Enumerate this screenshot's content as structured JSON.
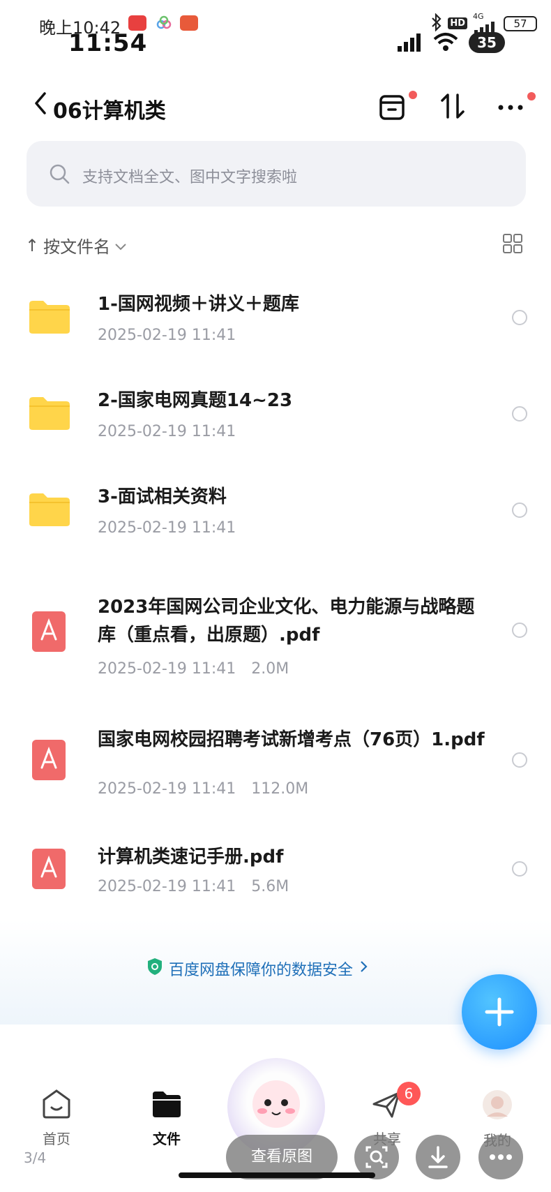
{
  "status_bar": {
    "time_small": "晚上10:42",
    "time_big": "11:54",
    "network": "4G",
    "battery": "57",
    "pill": "35"
  },
  "header": {
    "title": "06计算机类"
  },
  "search": {
    "placeholder": "支持文档全文、图中文字搜索啦"
  },
  "sort": {
    "label": "按文件名"
  },
  "files": [
    {
      "type": "folder",
      "name": "1-国网视频＋讲义＋题库",
      "date": "2025-02-19 11:41",
      "size": ""
    },
    {
      "type": "folder",
      "name": "2-国家电网真题14~23",
      "date": "2025-02-19 11:41",
      "size": ""
    },
    {
      "type": "folder",
      "name": "3-面试相关资料",
      "date": "2025-02-19 11:41",
      "size": ""
    },
    {
      "type": "pdf",
      "name": "2023年国网公司企业文化、电力能源与战略题库（重点看，出原题）.pdf",
      "date": "2025-02-19 11:41",
      "size": "2.0M"
    },
    {
      "type": "pdf",
      "name": "国家电网校园招聘考试新增考点（76页）1.pdf",
      "date": "2025-02-19 11:41",
      "size": "112.0M"
    },
    {
      "type": "pdf",
      "name": "计算机类速记手册.pdf",
      "date": "2025-02-19 11:41",
      "size": "5.6M"
    }
  ],
  "safety": {
    "text": "百度网盘保障你的数据安全"
  },
  "nav": {
    "home": "首页",
    "files": "文件",
    "share": "共享",
    "share_badge": "6",
    "me": "我的"
  },
  "viewer": {
    "pager": "3/4",
    "view_original": "查看原图"
  },
  "colors": {
    "folder": "#ffd54a",
    "pdf": "#f06a6a",
    "accent": "#1d8fff",
    "badge": "#ff5757"
  }
}
